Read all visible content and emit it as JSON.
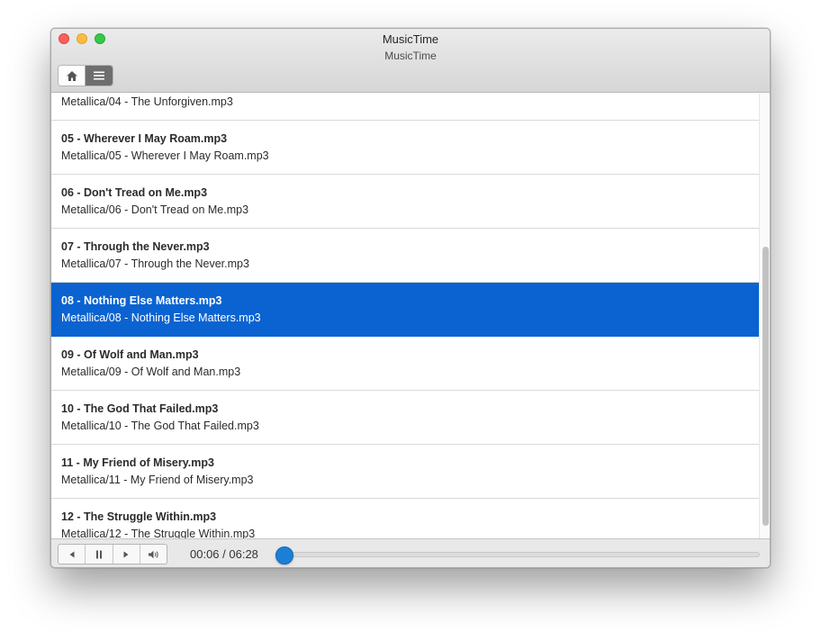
{
  "window": {
    "title": "MusicTime"
  },
  "app": {
    "subtitle": "MusicTime"
  },
  "toolbar": {
    "home_icon": "home-icon",
    "list_icon": "list-icon",
    "active": "list"
  },
  "tracks": [
    {
      "title": "",
      "path": "Metallica/04 - The Unforgiven.mp3",
      "partial": true
    },
    {
      "title": "05 - Wherever I May Roam.mp3",
      "path": "Metallica/05 - Wherever I May Roam.mp3"
    },
    {
      "title": "06 - Don't Tread on Me.mp3",
      "path": "Metallica/06 - Don't Tread on Me.mp3"
    },
    {
      "title": "07 - Through the Never.mp3",
      "path": "Metallica/07 - Through the Never.mp3"
    },
    {
      "title": "08 - Nothing Else Matters.mp3",
      "path": "Metallica/08 - Nothing Else Matters.mp3",
      "selected": true
    },
    {
      "title": "09 - Of Wolf and Man.mp3",
      "path": "Metallica/09 - Of Wolf and Man.mp3"
    },
    {
      "title": "10 - The God That Failed.mp3",
      "path": "Metallica/10 - The God That Failed.mp3"
    },
    {
      "title": "11 - My Friend of Misery.mp3",
      "path": "Metallica/11 - My Friend of Misery.mp3"
    },
    {
      "title": "12 - The Struggle Within.mp3",
      "path": "Metallica/12 - The Struggle Within.mp3"
    }
  ],
  "player": {
    "time": "00:06 / 06:28",
    "progress": 0.015,
    "controls": [
      "previous-icon",
      "pause-icon",
      "next-icon",
      "volume-icon"
    ]
  },
  "colors": {
    "selection": "#0a63d1",
    "accent": "#1c7fd6"
  }
}
